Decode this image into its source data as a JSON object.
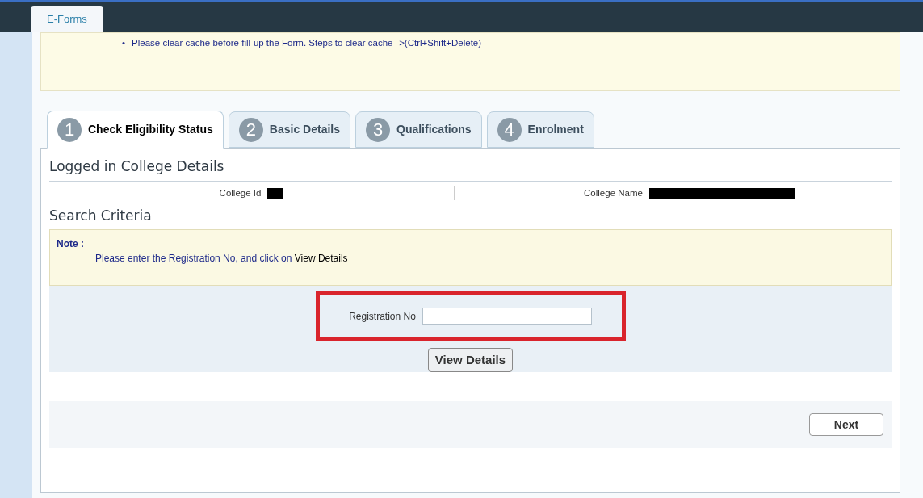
{
  "top_tab": {
    "label": "E-Forms",
    "selected": true
  },
  "notice": {
    "bullet": "•",
    "text": "Please clear cache before fill-up the Form. Steps to clear cache-->(Ctrl+Shift+Delete)"
  },
  "steps": [
    {
      "number": "1",
      "label": "Check Eligibility Status",
      "selected": true
    },
    {
      "number": "2",
      "label": "Basic Details",
      "selected": false
    },
    {
      "number": "3",
      "label": "Qualifications",
      "selected": false
    },
    {
      "number": "4",
      "label": "Enrolment",
      "selected": false
    }
  ],
  "college_section": {
    "title": "Logged in College Details",
    "fields": [
      {
        "label": "College Id",
        "kind": "short"
      },
      {
        "label": "College Name",
        "kind": "long"
      }
    ]
  },
  "search_section": {
    "title": "Search Criteria",
    "note_label": "Note :",
    "note_text": "Please enter the Registration No, and click on",
    "note_action": "View Details",
    "field_label": "Registration No",
    "highlighted": true,
    "button": "View Details"
  },
  "next_button": "Next"
}
